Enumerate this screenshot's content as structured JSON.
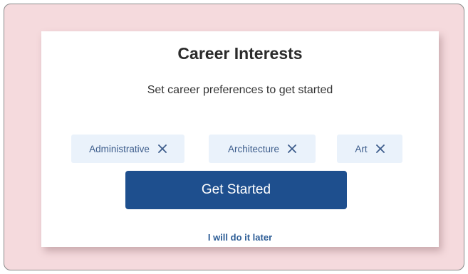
{
  "card": {
    "title": "Career Interests",
    "subtitle": "Set career preferences to get started"
  },
  "chips": [
    {
      "label": "Administrative",
      "icon": "close-icon"
    },
    {
      "label": "Architecture",
      "icon": "close-icon"
    },
    {
      "label": "Art",
      "icon": "close-icon"
    }
  ],
  "actions": {
    "get_started_label": "Get Started",
    "later_label": "I will do it later"
  },
  "colors": {
    "background": "#f5dadd",
    "primary": "#1e4f8e",
    "chip_bg": "#eaf2fb",
    "chip_text": "#3d5d8c",
    "link": "#2d5d96"
  }
}
